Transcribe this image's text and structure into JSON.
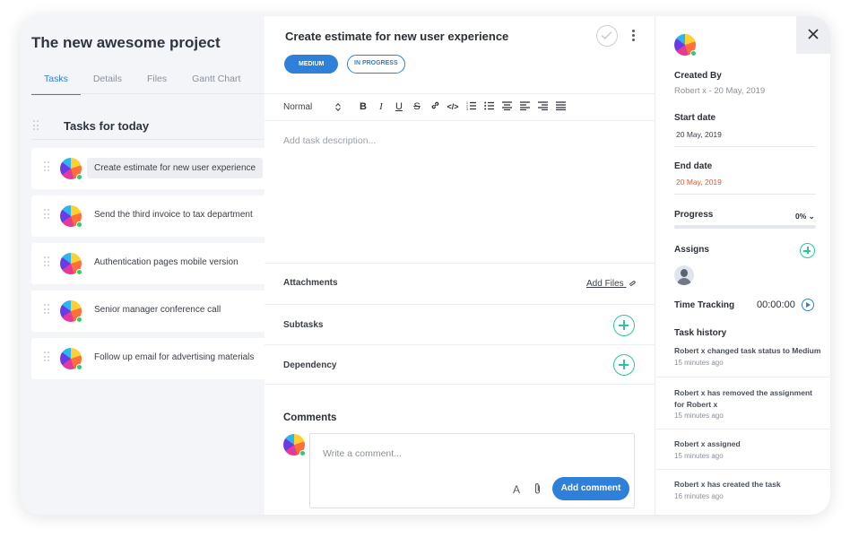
{
  "project": {
    "title": "The new awesome project",
    "tabs": [
      {
        "label": "Tasks",
        "active": true
      },
      {
        "label": "Details"
      },
      {
        "label": "Files"
      },
      {
        "label": "Gantt Chart"
      }
    ],
    "section_title": "Tasks for today",
    "tasks": [
      {
        "label": "Create estimate for new user experience",
        "selected": true
      },
      {
        "label": "Send the third invoice to tax department"
      },
      {
        "label": "Authentication pages mobile version"
      },
      {
        "label": "Senior manager conference call"
      },
      {
        "label": "Follow up email for advertising materials"
      }
    ]
  },
  "detail": {
    "title": "Create estimate for new user experience",
    "priority": "MEDIUM",
    "status": "IN PROGRESS",
    "text_format": "Normal",
    "description_placeholder": "Add task description...",
    "attachments_label": "Attachments",
    "add_files_label": "Add Files",
    "subtasks_label": "Subtasks",
    "dependency_label": "Dependency",
    "comments_label": "Comments",
    "comment_placeholder": "Write a comment...",
    "add_comment_label": "Add comment",
    "font_glyph": "A"
  },
  "side": {
    "created_by_label": "Created By",
    "created_by_value": "Robert x - 20 May, 2019",
    "start_date_label": "Start date",
    "start_date_value": "20 May, 2019",
    "end_date_label": "End date",
    "end_date_value": "20 May, 2019",
    "progress_label": "Progress",
    "progress_value": "0%",
    "progress_fraction": 0,
    "assigns_label": "Assigns",
    "time_tracking_label": "Time Tracking",
    "time_tracking_value": "00:00:00",
    "history_label": "Task history",
    "history": [
      {
        "message": "Robert x changed task status to Medium",
        "time": "15 minutes ago"
      },
      {
        "message": "Robert x has removed the assignment for Robert x",
        "time": "15 minutes ago"
      },
      {
        "message": "Robert x assigned",
        "time": "15 minutes ago"
      },
      {
        "message": "Robert x has created the task",
        "time": "16 minutes ago"
      }
    ]
  },
  "colors": {
    "accent": "#2f80d8",
    "success": "#2ec4a0",
    "danger": "#f0552a"
  }
}
